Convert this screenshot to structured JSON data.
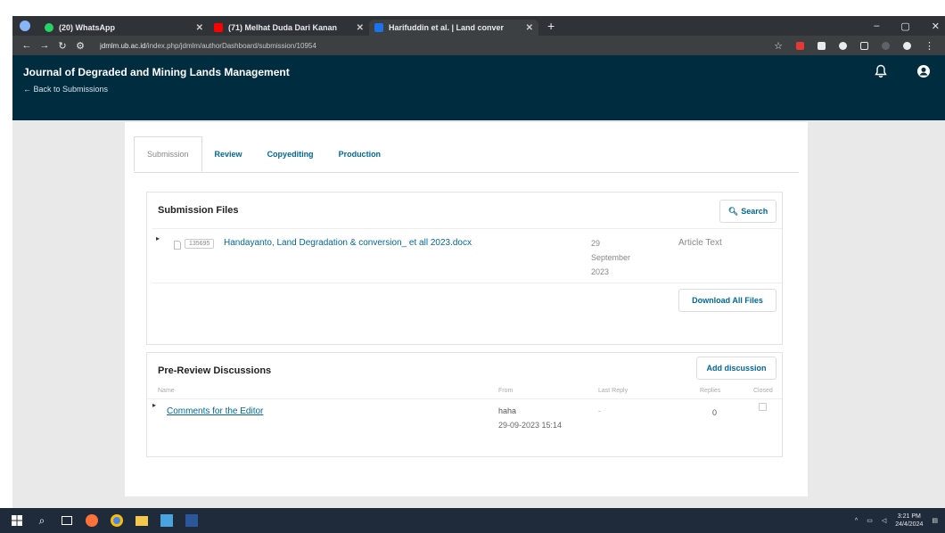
{
  "browser": {
    "tabs": [
      {
        "title": "(20) WhatsApp",
        "favicon_color": "#25d366"
      },
      {
        "title": "(71) Melhat Duda Dari Kanan",
        "favicon_color": "#ff0000"
      },
      {
        "title": "Harifuddin et al. | Land conver",
        "favicon_color": "#1a73e8"
      }
    ],
    "url_host": "jdmlm.ub.ac.id",
    "url_path": "/index.php/jdmlm/authorDashboard/submission/10954"
  },
  "app": {
    "journal_title": "Journal of Degraded and Mining Lands Management",
    "back_link": "← Back to Submissions"
  },
  "workflow_tabs": [
    "Submission",
    "Review",
    "Copyediting",
    "Production"
  ],
  "submission_files": {
    "heading": "Submission Files",
    "search_label": "Search",
    "download_all_label": "Download All Files",
    "files": [
      {
        "id": "135695",
        "name": "Handayanto, Land Degradation & conversion_ et all 2023.docx",
        "date_line1": "29",
        "date_line2": "September",
        "date_line3": "2023",
        "type": "Article Text"
      }
    ]
  },
  "discussions": {
    "heading": "Pre-Review Discussions",
    "add_label": "Add discussion",
    "columns": {
      "name": "Name",
      "from": "From",
      "last_reply": "Last Reply",
      "replies": "Replies",
      "closed": "Closed"
    },
    "rows": [
      {
        "name": "Comments for the Editor",
        "from": "haha",
        "from_time": "29-09-2023 15:14",
        "last_reply": "-",
        "replies": "0"
      }
    ]
  },
  "taskbar": {
    "time": "3:21 PM",
    "date": "24/4/2024"
  },
  "colors": {
    "header_bg": "#002c40",
    "link": "#006798"
  }
}
